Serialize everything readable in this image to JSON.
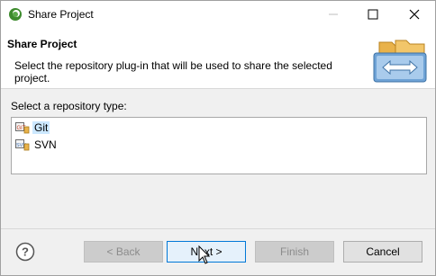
{
  "window": {
    "title": "Share Project"
  },
  "header": {
    "title": "Share Project",
    "description": "Select the repository plug-in that will be used to share the selected project."
  },
  "repository": {
    "label": "Select a repository type:",
    "items": [
      {
        "label": "Git",
        "icon": "git-repo-icon",
        "selected": true
      },
      {
        "label": "SVN",
        "icon": "svn-repo-icon",
        "selected": false
      }
    ]
  },
  "buttons": {
    "back": "< Back",
    "next": "Next >",
    "finish": "Finish",
    "cancel": "Cancel"
  },
  "icons": {
    "app": "eclipse-icon",
    "help": "help-icon",
    "wizard": "share-folders-icon"
  },
  "colors": {
    "selection": "#cce8ff",
    "default_button_border": "#0078d7"
  }
}
